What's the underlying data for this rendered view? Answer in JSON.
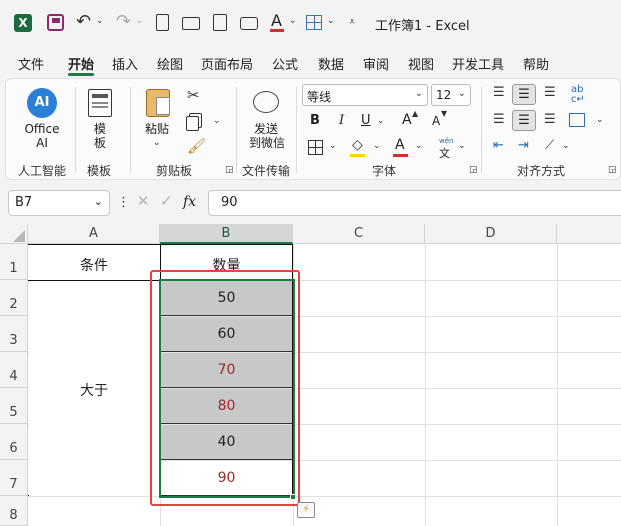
{
  "window": {
    "title": "工作簿1 - Excel"
  },
  "tabs": [
    "文件",
    "开始",
    "插入",
    "绘图",
    "页面布局",
    "公式",
    "数据",
    "审阅",
    "视图",
    "开发工具",
    "帮助"
  ],
  "ribbon": {
    "ai": {
      "button": "Office AI",
      "label_line1": "Office",
      "label_line2": "AI",
      "group": "人工智能"
    },
    "template": {
      "button_line1": "模",
      "button_line2": "板",
      "group": "模板"
    },
    "clipboard": {
      "paste": "粘贴",
      "group": "剪贴板"
    },
    "transfer": {
      "line1": "发送",
      "line2": "到微信",
      "group": "文件传输"
    },
    "font": {
      "family": "等线",
      "size": "12",
      "group": "字体",
      "bold": "B",
      "italic": "I",
      "underline": "U",
      "grow": "A",
      "shrink": "A",
      "font_color": "A",
      "phonetic_top": "wén",
      "phonetic_bottom": "文"
    },
    "align": {
      "group": "对齐方式"
    }
  },
  "formula_bar": {
    "name_box": "B7",
    "fx": "fx",
    "value": "90"
  },
  "sheet": {
    "columns": [
      "A",
      "B",
      "C",
      "D"
    ],
    "rows": [
      "1",
      "2",
      "3",
      "4",
      "5",
      "6",
      "7",
      "8"
    ],
    "header_condition": "条件",
    "header_quantity": "数量",
    "merged_condition": "大于",
    "values": [
      "50",
      "60",
      "70",
      "80",
      "40",
      "90"
    ],
    "value_colors": [
      "#222222",
      "#222222",
      "#9c2b2b",
      "#9c2b2b",
      "#222222",
      "#9c2b2b"
    ],
    "value_fills": [
      "#c8c8c8",
      "#c8c8c8",
      "#c8c8c8",
      "#c8c8c8",
      "#c8c8c8",
      "#ffffff"
    ]
  },
  "colors": {
    "accent": "#1f7a45",
    "highlight_box": "#e34343"
  }
}
